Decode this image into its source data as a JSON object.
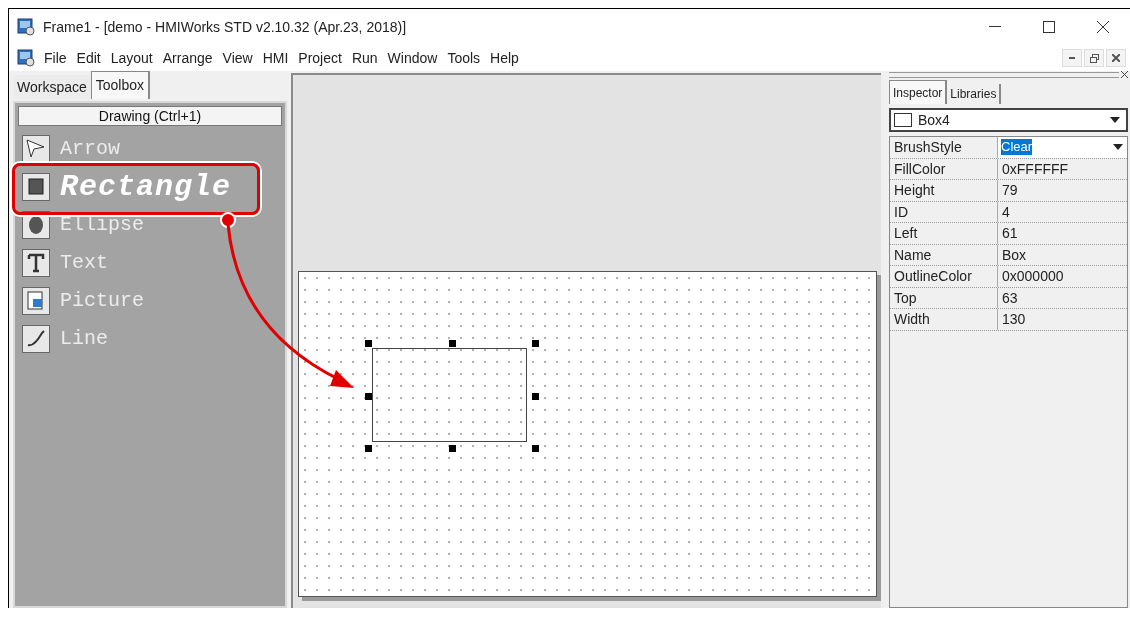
{
  "window": {
    "title": "Frame1 - [demo - HMIWorks STD v2.10.32 (Apr.23, 2018)]"
  },
  "menu": [
    "File",
    "Edit",
    "Layout",
    "Arrange",
    "View",
    "HMI",
    "Project",
    "Run",
    "Window",
    "Tools",
    "Help"
  ],
  "left_tabs": [
    {
      "label": "Workspace",
      "selected": false
    },
    {
      "label": "Toolbox",
      "selected": true
    }
  ],
  "toolbox": {
    "header": "Drawing (Ctrl+1)",
    "items": [
      {
        "label": "Arrow",
        "kind": "arrow",
        "selected": false
      },
      {
        "label": "Rectangle",
        "kind": "rectangle",
        "selected": true
      },
      {
        "label": "Ellipse",
        "kind": "ellipse",
        "selected": false
      },
      {
        "label": "Text",
        "kind": "text",
        "selected": false
      },
      {
        "label": "Picture",
        "kind": "picture",
        "selected": false
      },
      {
        "label": "Line",
        "kind": "line",
        "selected": false
      }
    ]
  },
  "right_tabs": [
    {
      "label": "Inspector",
      "selected": true
    },
    {
      "label": "Libraries",
      "selected": false
    }
  ],
  "inspector": {
    "object": "Box4",
    "properties": [
      {
        "name": "BrushStyle",
        "value": "Clear",
        "kind": "select"
      },
      {
        "name": "FillColor",
        "value": "0xFFFFFF",
        "kind": "text"
      },
      {
        "name": "Height",
        "value": "79",
        "kind": "text"
      },
      {
        "name": "ID",
        "value": "4",
        "kind": "text"
      },
      {
        "name": "Left",
        "value": "61",
        "kind": "text"
      },
      {
        "name": "Name",
        "value": "Box",
        "kind": "text"
      },
      {
        "name": "OutlineColor",
        "value": "0x000000",
        "kind": "text"
      },
      {
        "name": "Top",
        "value": "63",
        "kind": "text"
      },
      {
        "name": "Width",
        "value": "130",
        "kind": "text"
      }
    ]
  }
}
